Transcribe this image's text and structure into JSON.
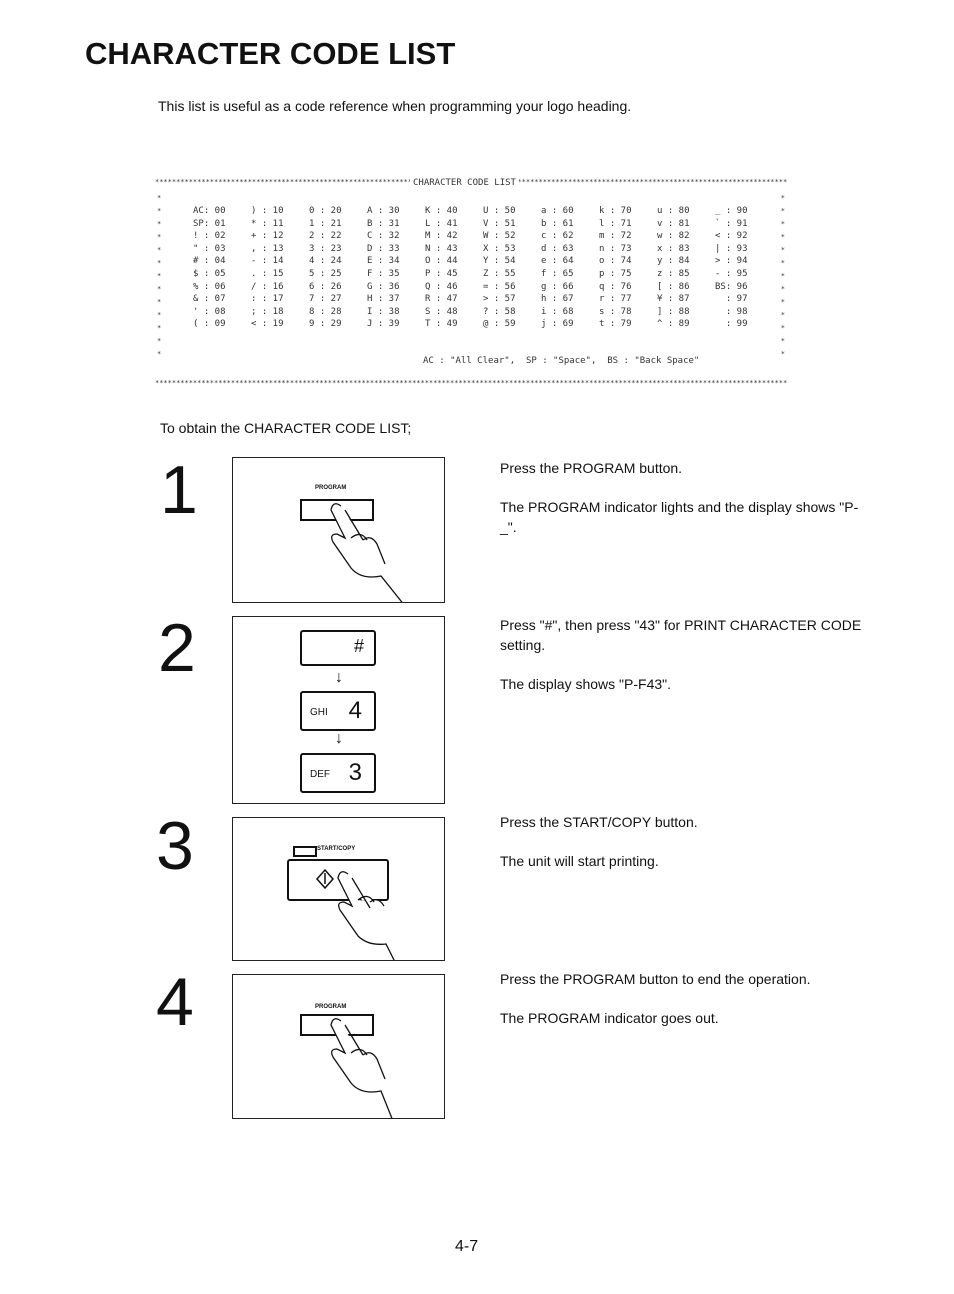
{
  "title": "CHARACTER CODE LIST",
  "intro": "This list is useful as a code reference when programming your logo heading.",
  "code_list": {
    "header": "CHARACTER CODE LIST",
    "columns": [
      [
        "AC: 00",
        "SP: 01",
        "! : 02",
        "\" : 03",
        "# : 04",
        "$ : 05",
        "% : 06",
        "& : 07",
        "' : 08",
        "( : 09"
      ],
      [
        ") : 10",
        "* : 11",
        "+ : 12",
        ", : 13",
        "- : 14",
        ". : 15",
        "/ : 16",
        ": : 17",
        "; : 18",
        "< : 19"
      ],
      [
        "0 : 20",
        "1 : 21",
        "2 : 22",
        "3 : 23",
        "4 : 24",
        "5 : 25",
        "6 : 26",
        "7 : 27",
        "8 : 28",
        "9 : 29"
      ],
      [
        "A : 30",
        "B : 31",
        "C : 32",
        "D : 33",
        "E : 34",
        "F : 35",
        "G : 36",
        "H : 37",
        "I : 38",
        "J : 39"
      ],
      [
        "K : 40",
        "L : 41",
        "M : 42",
        "N : 43",
        "O : 44",
        "P : 45",
        "Q : 46",
        "R : 47",
        "S : 48",
        "T : 49"
      ],
      [
        "U : 50",
        "V : 51",
        "W : 52",
        "X : 53",
        "Y : 54",
        "Z : 55",
        "= : 56",
        "> : 57",
        "? : 58",
        "@ : 59"
      ],
      [
        "a : 60",
        "b : 61",
        "c : 62",
        "d : 63",
        "e : 64",
        "f : 65",
        "g : 66",
        "h : 67",
        "i : 68",
        "j : 69"
      ],
      [
        "k : 70",
        "l : 71",
        "m : 72",
        "n : 73",
        "o : 74",
        "p : 75",
        "q : 76",
        "r : 77",
        "s : 78",
        "t : 79"
      ],
      [
        "u : 80",
        "v : 81",
        "w : 82",
        "x : 83",
        "y : 84",
        "z : 85",
        "[ : 86",
        "¥ : 87",
        "] : 88",
        "^ : 89"
      ],
      [
        "_ : 90",
        "` : 91",
        "< : 92",
        "| : 93",
        "> : 94",
        "- : 95",
        "BS: 96",
        "  : 97",
        "  : 98",
        "  : 99"
      ]
    ],
    "legend": "AC : \"All Clear\",  SP : \"Space\",  BS : \"Back Space\""
  },
  "obtain": "To obtain the CHARACTER CODE LIST;",
  "steps": [
    {
      "number": "1",
      "panel_label": "PROGRAM",
      "desc": [
        "Press the PROGRAM button.",
        "The PROGRAM indicator lights and the display shows \"P-_\"."
      ]
    },
    {
      "number": "2",
      "keys": [
        {
          "letters": "",
          "digit": "#"
        },
        {
          "letters": "GHI",
          "digit": "4"
        },
        {
          "letters": "DEF",
          "digit": "3"
        }
      ],
      "desc": [
        "Press \"#\", then press \"43\" for PRINT CHARACTER CODE setting.",
        "The display shows \"P-F43\"."
      ]
    },
    {
      "number": "3",
      "panel_label": "START/COPY",
      "desc": [
        "Press the START/COPY button.",
        "The unit will start printing."
      ]
    },
    {
      "number": "4",
      "panel_label": "PROGRAM",
      "desc": [
        "Press the PROGRAM button to end the operation.",
        "The PROGRAM indicator goes out."
      ]
    }
  ],
  "page_number": "4-7"
}
